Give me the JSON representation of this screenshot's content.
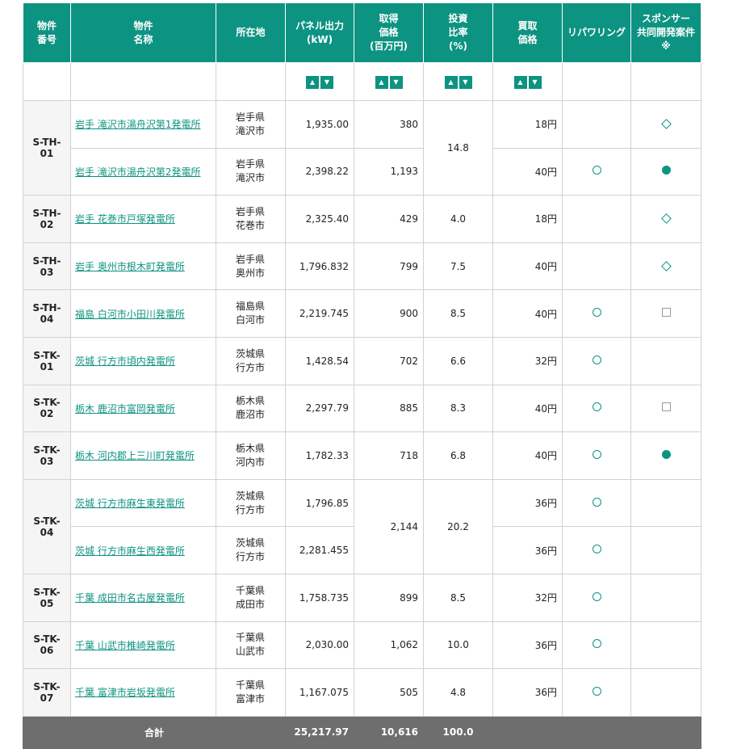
{
  "headers": [
    "物件\n番号",
    "物件\n名称",
    "所在地",
    "パネル出力\n(kW)",
    "取得\n価格\n(百万円)",
    "投資\n比率\n(%)",
    "買取\n価格",
    "リパワリング",
    "スポンサー\n共同開発案件\n※"
  ],
  "rows": [
    {
      "id": "S-TH-01",
      "name": "岩手 滝沢市湯舟沢第1発電所",
      "loc1": "岩手県",
      "loc2": "滝沢市",
      "panel": "1,935.00",
      "price": "380",
      "ratio": "14.8",
      "fit": "18円",
      "repower": "",
      "sponsor": "diamond"
    },
    {
      "id": "",
      "name": "岩手 滝沢市湯舟沢第2発電所",
      "loc1": "岩手県",
      "loc2": "滝沢市",
      "panel": "2,398.22",
      "price": "1,193",
      "ratio": "",
      "fit": "40円",
      "repower": "circle",
      "sponsor": "dot"
    },
    {
      "id": "S-TH-02",
      "name": "岩手 花巻市戸塚発電所",
      "loc1": "岩手県",
      "loc2": "花巻市",
      "panel": "2,325.40",
      "price": "429",
      "ratio": "4.0",
      "fit": "18円",
      "repower": "",
      "sponsor": "diamond"
    },
    {
      "id": "S-TH-03",
      "name": "岩手 奥州市根木町発電所",
      "loc1": "岩手県",
      "loc2": "奥州市",
      "panel": "1,796.832",
      "price": "799",
      "ratio": "7.5",
      "fit": "40円",
      "repower": "",
      "sponsor": "diamond"
    },
    {
      "id": "S-TH-04",
      "name": "福島 白河市小田川発電所",
      "loc1": "福島県",
      "loc2": "白河市",
      "panel": "2,219.745",
      "price": "900",
      "ratio": "8.5",
      "fit": "40円",
      "repower": "circle",
      "sponsor": "square"
    },
    {
      "id": "S-TK-01",
      "name": "茨城 行方市頃内発電所",
      "loc1": "茨城県",
      "loc2": "行方市",
      "panel": "1,428.54",
      "price": "702",
      "ratio": "6.6",
      "fit": "32円",
      "repower": "circle",
      "sponsor": ""
    },
    {
      "id": "S-TK-02",
      "name": "栃木 鹿沼市富岡発電所",
      "loc1": "栃木県",
      "loc2": "鹿沼市",
      "panel": "2,297.79",
      "price": "885",
      "ratio": "8.3",
      "fit": "40円",
      "repower": "circle",
      "sponsor": "square"
    },
    {
      "id": "S-TK-03",
      "name": "栃木 河内郡上三川町発電所",
      "loc1": "栃木県",
      "loc2": "河内市",
      "panel": "1,782.33",
      "price": "718",
      "ratio": "6.8",
      "fit": "40円",
      "repower": "circle",
      "sponsor": "dot"
    },
    {
      "id": "S-TK-04",
      "name": "茨城 行方市麻生東発電所",
      "loc1": "茨城県",
      "loc2": "行方市",
      "panel": "1,796.85",
      "price": "2,144",
      "ratio": "20.2",
      "fit": "36円",
      "repower": "circle",
      "sponsor": ""
    },
    {
      "id": "",
      "name": "茨城 行方市麻生西発電所",
      "loc1": "茨城県",
      "loc2": "行方市",
      "panel": "2,281.455",
      "price": "",
      "ratio": "",
      "fit": "36円",
      "repower": "circle",
      "sponsor": ""
    },
    {
      "id": "S-TK-05",
      "name": "千葉 成田市名古屋発電所",
      "loc1": "千葉県",
      "loc2": "成田市",
      "panel": "1,758.735",
      "price": "899",
      "ratio": "8.5",
      "fit": "32円",
      "repower": "circle",
      "sponsor": ""
    },
    {
      "id": "S-TK-06",
      "name": "千葉 山武市椎崎発電所",
      "loc1": "千葉県",
      "loc2": "山武市",
      "panel": "2,030.00",
      "price": "1,062",
      "ratio": "10.0",
      "fit": "36円",
      "repower": "circle",
      "sponsor": ""
    },
    {
      "id": "S-TK-07",
      "name": "千葉 富津市岩坂発電所",
      "loc1": "千葉県",
      "loc2": "富津市",
      "panel": "1,167.075",
      "price": "505",
      "ratio": "4.8",
      "fit": "36円",
      "repower": "circle",
      "sponsor": ""
    }
  ],
  "footer": {
    "label": "合計",
    "panel": "25,217.97",
    "price": "10,616",
    "ratio": "100.0"
  }
}
